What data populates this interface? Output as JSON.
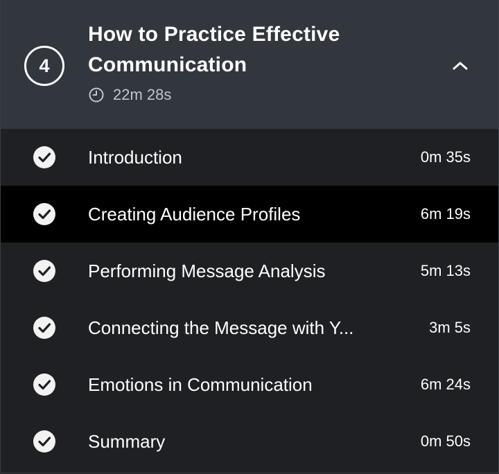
{
  "module": {
    "number": "4",
    "title": "How to Practice Effective Communication",
    "duration": "22m 28s",
    "clock_icon": "clock-icon",
    "collapse_icon": "chevron-up-icon",
    "expanded": true
  },
  "colors": {
    "header_bg": "#32373d",
    "list_bg": "#1e2024",
    "active_bg": "#000000",
    "text": "#ffffff",
    "muted_text": "#c2c6cc",
    "check_fill": "#f2f2f2"
  },
  "clips": [
    {
      "title": "Introduction",
      "duration": "0m 35s",
      "completed": true,
      "active": false
    },
    {
      "title": "Creating Audience Profiles",
      "duration": "6m 19s",
      "completed": true,
      "active": true
    },
    {
      "title": "Performing Message Analysis",
      "duration": "5m 13s",
      "completed": true,
      "active": false
    },
    {
      "title": "Connecting the Message with Y...",
      "duration": "3m 5s",
      "completed": true,
      "active": false
    },
    {
      "title": "Emotions in Communication",
      "duration": "6m 24s",
      "completed": true,
      "active": false
    },
    {
      "title": "Summary",
      "duration": "0m 50s",
      "completed": true,
      "active": false
    }
  ]
}
